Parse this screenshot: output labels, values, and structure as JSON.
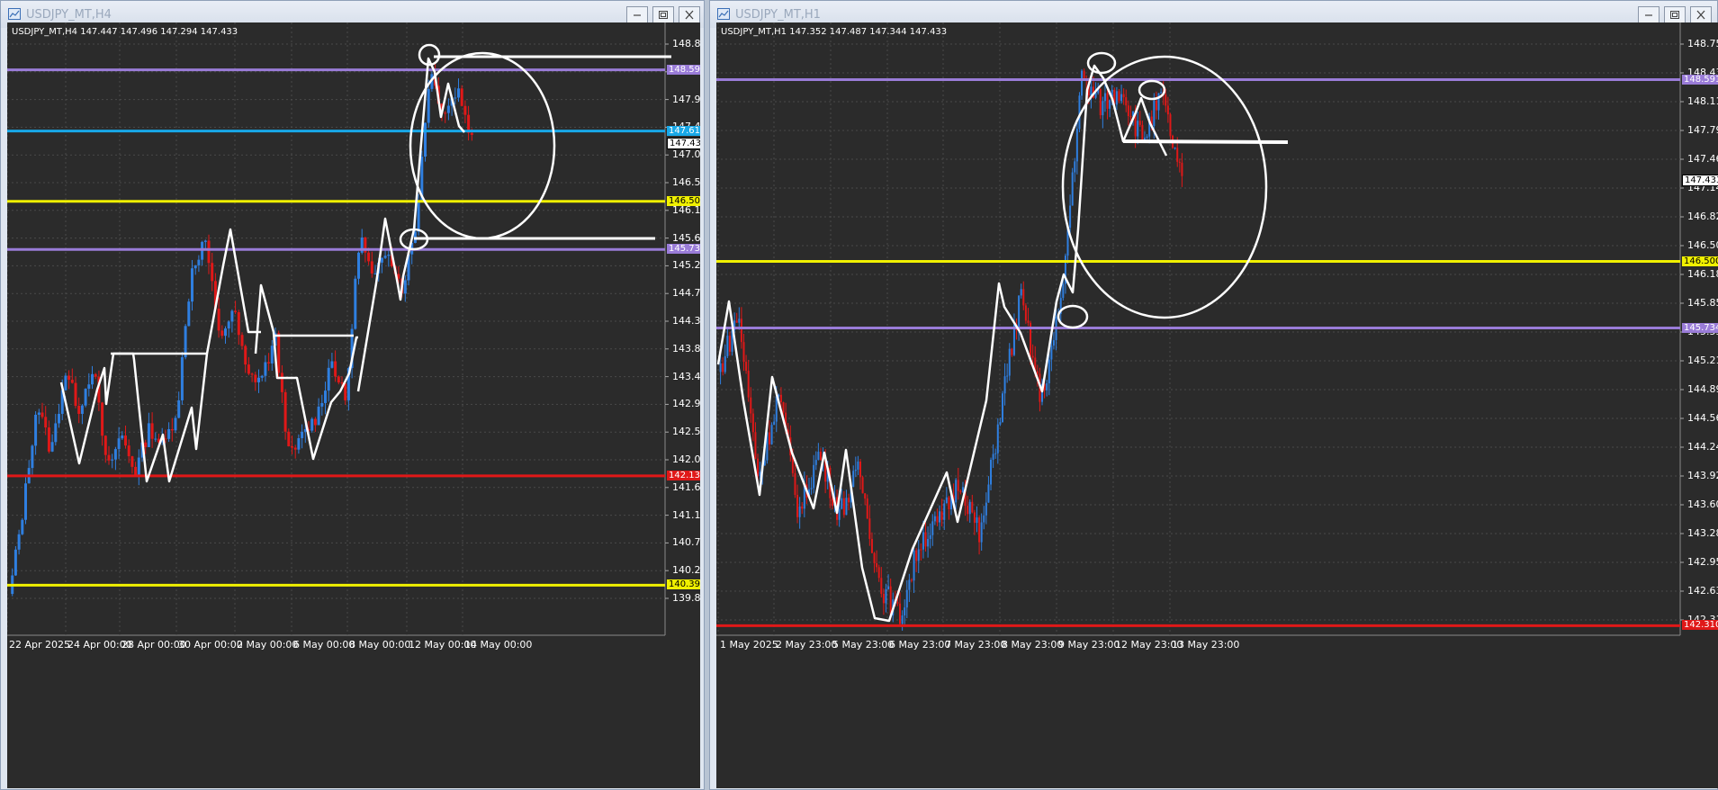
{
  "colors": {
    "purple": "#9a7cd8",
    "cyan": "#18a8e8",
    "yellow": "#f0f000",
    "red": "#e01818",
    "bull": "#2f7fe0",
    "bear": "#e01818",
    "annotation": "#ffffff",
    "chart_bg": "#2b2b2b",
    "grid": "#4a4a4a"
  },
  "windows": [
    {
      "title": "USDJPY_MT,H4",
      "ohlc": "USDJPY_MT,H4  147.447 147.496 147.294 147.433",
      "icons": [
        "chart-window-icon",
        "minimize-icon",
        "restore-icon",
        "close-icon"
      ],
      "price_ticks": [
        "148.800",
        "148.350",
        "147.905",
        "147.455",
        "147.005",
        "146.555",
        "146.110",
        "145.660",
        "145.210",
        "144.760",
        "144.315",
        "143.865",
        "143.415",
        "142.970",
        "142.520",
        "142.070",
        "141.620",
        "141.175",
        "140.725",
        "140.275",
        "139.825"
      ],
      "time_ticks": [
        "22 Apr 2025",
        "24 Apr 00:00",
        "28 Apr 00:00",
        "30 Apr 00:00",
        "2 May 00:00",
        "6 May 00:00",
        "8 May 00:00",
        "12 May 00:00",
        "14 May 00:00"
      ],
      "hlines": [
        {
          "color": "purple",
          "label": "148.591"
        },
        {
          "color": "cyan",
          "label": "147.618"
        },
        {
          "color": "white",
          "label": "147.433"
        },
        {
          "color": "yellow",
          "label": "146.500"
        },
        {
          "color": "purple",
          "label": "145.734"
        },
        {
          "color": "red",
          "label": "142.135"
        },
        {
          "color": "yellow",
          "label": "140.396"
        }
      ]
    },
    {
      "title": "USDJPY_MT,H1",
      "ohlc": "USDJPY_MT,H1  147.352 147.487 147.344 147.433",
      "icons": [
        "chart-window-icon",
        "minimize-icon",
        "restore-icon",
        "close-icon"
      ],
      "price_ticks": [
        "148.755",
        "148.435",
        "148.110",
        "147.790",
        "147.465",
        "147.145",
        "146.820",
        "146.500",
        "146.180",
        "145.855",
        "145.535",
        "145.210",
        "144.890",
        "144.565",
        "144.245",
        "143.920",
        "143.600",
        "143.280",
        "142.955",
        "142.635",
        "142.310"
      ],
      "time_ticks": [
        "1 May 2025",
        "2 May 23:00",
        "5 May 23:00",
        "6 May 23:00",
        "7 May 23:00",
        "8 May 23:00",
        "9 May 23:00",
        "12 May 23:00",
        "13 May 23:00"
      ],
      "hlines": [
        {
          "color": "purple",
          "label": "148.591"
        },
        {
          "color": "white",
          "label": "147.433"
        },
        {
          "color": "yellow",
          "label": "146.500"
        },
        {
          "color": "purple",
          "label": "145.734"
        },
        {
          "color": "red",
          "label": "142.310"
        }
      ]
    }
  ],
  "chart_data": [
    {
      "type": "candlestick",
      "symbol": "USDJPY_MT",
      "timeframe": "H4",
      "ylim": [
        139.6,
        149.0
      ],
      "x": [
        "22 Apr",
        "23 Apr",
        "24 Apr",
        "25 Apr",
        "28 Apr",
        "29 Apr",
        "30 Apr",
        "1 May",
        "2 May",
        "5 May",
        "6 May",
        "7 May",
        "8 May",
        "9 May",
        "12 May",
        "13 May",
        "14 May"
      ],
      "close_path": [
        140.2,
        141.6,
        143.3,
        142.5,
        143.8,
        143.2,
        143.9,
        142.2,
        142.8,
        142.2,
        142.9,
        142.6,
        143.2,
        145.4,
        145.9,
        144.3,
        144.8,
        143.7,
        143.7,
        144.3,
        142.4,
        142.8,
        143.1,
        144.0,
        143.3,
        146.0,
        145.2,
        145.8,
        145.1,
        146.1,
        148.6,
        147.9,
        148.3,
        147.5
      ],
      "levels": [
        148.591,
        147.618,
        146.5,
        145.734,
        142.135,
        140.396
      ],
      "current": 147.433
    },
    {
      "type": "candlestick",
      "symbol": "USDJPY_MT",
      "timeframe": "H1",
      "ylim": [
        142.2,
        149.0
      ],
      "x": [
        "1 May",
        "2 May",
        "5 May",
        "6 May",
        "7 May",
        "8 May",
        "9 May",
        "12 May",
        "13 May"
      ],
      "close_path": [
        145.2,
        145.9,
        144.0,
        145.0,
        143.6,
        144.3,
        143.6,
        144.1,
        142.8,
        142.4,
        143.3,
        143.5,
        144.0,
        143.3,
        144.8,
        146.1,
        144.9,
        146.0,
        148.6,
        148.3,
        148.5,
        147.9,
        148.4,
        147.4
      ],
      "levels": [
        148.591,
        146.5,
        145.734,
        142.31
      ],
      "current": 147.433
    }
  ]
}
